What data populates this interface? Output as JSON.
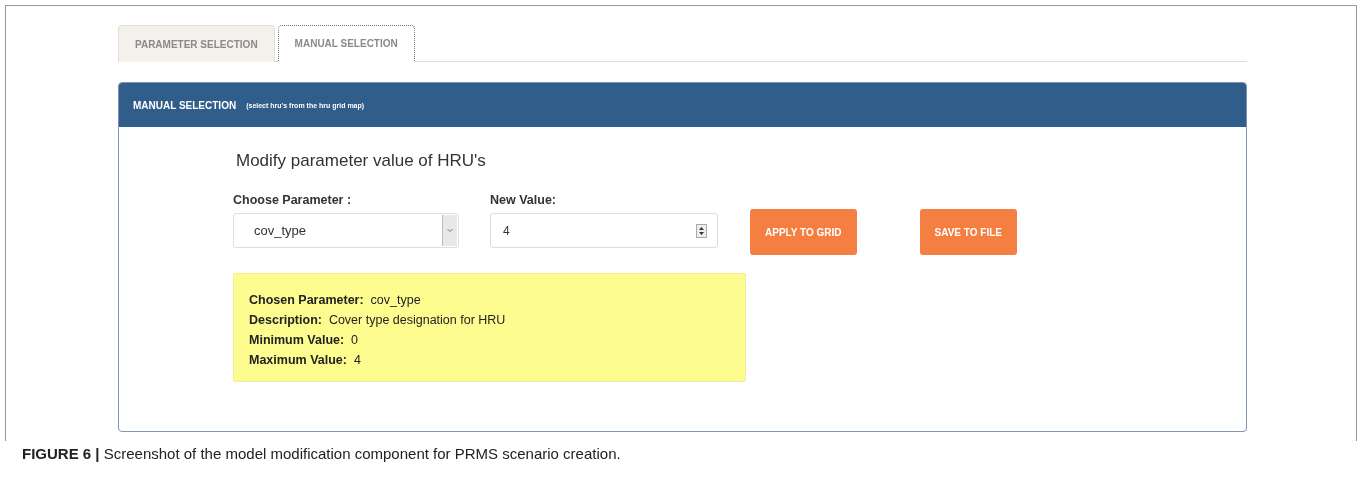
{
  "tabs": [
    {
      "label": "PARAMETER SELECTION",
      "selected": false
    },
    {
      "label": "MANUAL SELECTION",
      "selected": true
    }
  ],
  "panel": {
    "title": "MANUAL SELECTION",
    "subtitle": "(select hru's from the hru grid map)",
    "heading": "Modify parameter value of HRU's",
    "parameter": {
      "label": "Choose Parameter :",
      "value": "cov_type"
    },
    "new_value": {
      "label": "New Value:",
      "value": "4"
    },
    "buttons": [
      "APPLY TO GRID",
      "SAVE TO FILE"
    ],
    "info": [
      {
        "label": "Chosen Parameter:",
        "value": "cov_type"
      },
      {
        "label": "Description:",
        "value": "Cover type designation for HRU"
      },
      {
        "label": "Minimum Value:",
        "value": "0"
      },
      {
        "label": "Maximum Value:",
        "value": "4"
      }
    ]
  },
  "caption": "**FIGURE 6 |** Screenshot of the model modification component for PRMS scenario creation."
}
